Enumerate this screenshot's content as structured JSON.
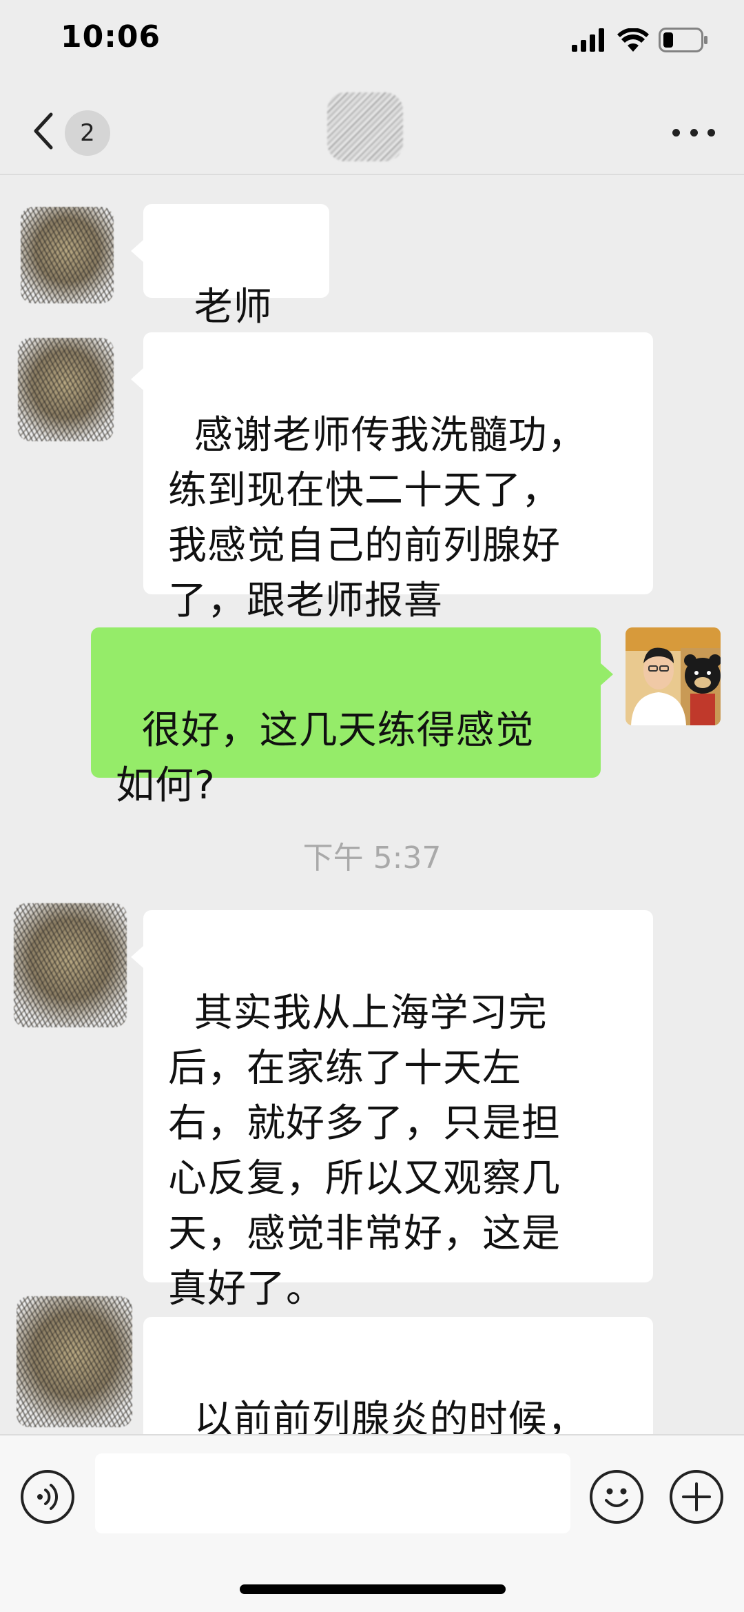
{
  "status_bar": {
    "time": "10:06",
    "icons": [
      "signal-icon",
      "wifi-icon",
      "battery-icon"
    ]
  },
  "nav": {
    "back_icon": "chevron-left-icon",
    "unread_count": "2",
    "more_icon": "more-dots-icon"
  },
  "messages": [
    {
      "side": "left",
      "text": "老师好"
    },
    {
      "side": "left",
      "text": "感谢老师传我洗髓功，\n练到现在快二十天了，\n我感觉自己的前列腺好\n了，跟老师报喜"
    },
    {
      "side": "right",
      "text": "很好，这几天练得感觉\n如何?"
    },
    {
      "side": "left",
      "text": "其实我从上海学习完\n后，在家练了十天左\n右，就好多了，只是担\n心反复，所以又观察几\n天，感觉非常好，这是\n真好了。"
    },
    {
      "side": "left",
      "text": "以前前列腺炎的时候，\n会尿频，过没多久就尿"
    }
  ],
  "timestamp": "下午 5:37",
  "input_bar": {
    "voice_icon": "voice-icon",
    "emoji_icon": "emoji-icon",
    "plus_icon": "plus-icon",
    "input_value": ""
  },
  "colors": {
    "background": "#ededed",
    "bubble_self": "#95ec69",
    "bubble_other": "#ffffff",
    "timestamp": "#a9a9a9"
  }
}
